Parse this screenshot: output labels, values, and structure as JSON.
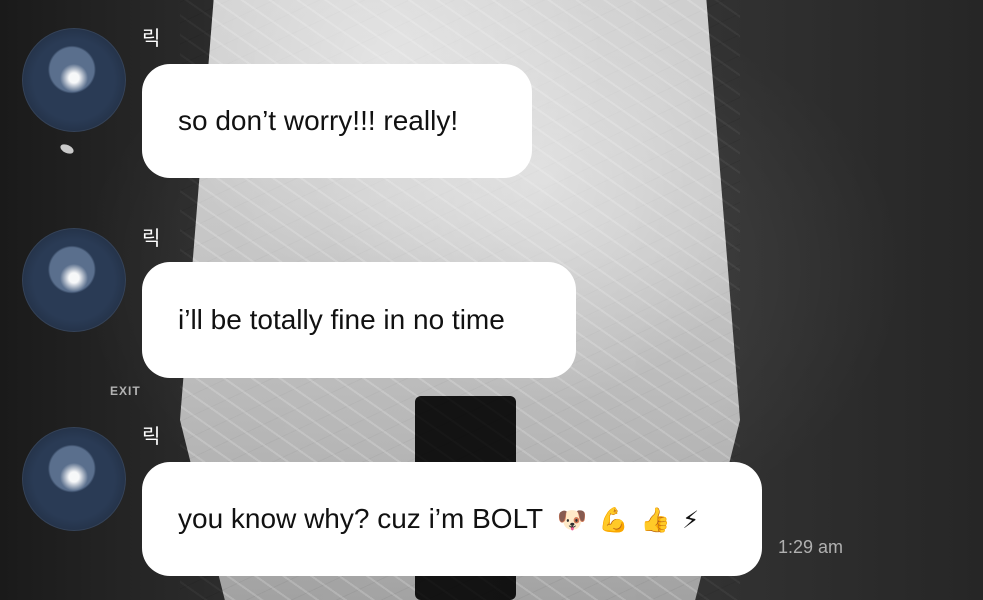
{
  "chat": {
    "messages": [
      {
        "sender": "릭",
        "text": "so don’t worry!!! really!"
      },
      {
        "sender": "릭",
        "text": "i’ll be totally fine in no time"
      },
      {
        "sender": "릭",
        "text": "you know why? cuz i’m BOLT",
        "emojis": [
          "🐶",
          "💪",
          "👍",
          "⚡"
        ]
      }
    ],
    "timestamp": "1:29 am"
  },
  "background": {
    "signs": [
      "EXIT"
    ]
  },
  "colors": {
    "bubble": "#ffffff",
    "text": "#111111",
    "sender": "#ffffff",
    "timestamp": "#b0b0b0",
    "background": "#2a2a2a"
  }
}
